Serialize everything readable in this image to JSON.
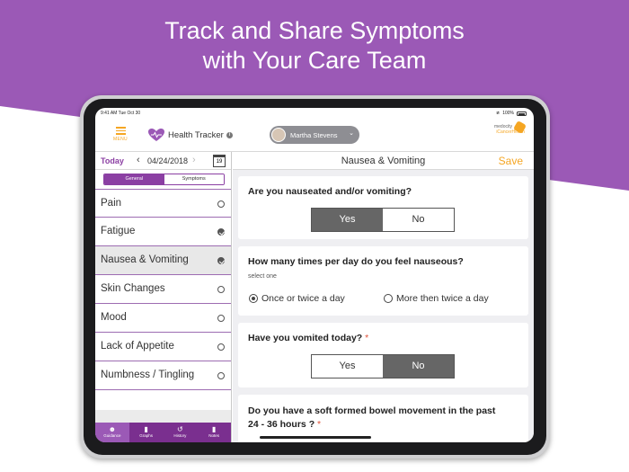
{
  "headline": {
    "line1": "Track and Share Symptoms",
    "line2": "with Your Care Team"
  },
  "colors": {
    "brand_purple": "#9b59b6",
    "dark_purple": "#7a2f8f",
    "accent_orange": "#f5a623",
    "required_red": "#e0533b"
  },
  "statusbar": {
    "time": "9:41 AM  Tue Oct 30",
    "battery": "100%"
  },
  "header": {
    "menu_label": "MENU",
    "app_name": "Health Tracker",
    "info_icon": "i",
    "user_name": "Martha Stevens",
    "partner_line1": "medocity",
    "partner_line2": "iCancerHealth"
  },
  "left": {
    "today_label": "Today",
    "date": "04/24/2018",
    "calendar_day": "19",
    "segment": {
      "general": "General",
      "symptoms": "Symptoms",
      "selected": "General"
    },
    "symptoms": [
      {
        "label": "Pain",
        "checked": false
      },
      {
        "label": "Fatigue",
        "checked": true
      },
      {
        "label": "Nausea & Vomiting",
        "checked": true,
        "active": true
      },
      {
        "label": "Skin Changes",
        "checked": false
      },
      {
        "label": "Mood",
        "checked": false
      },
      {
        "label": "Lack of Appetite",
        "checked": false
      },
      {
        "label": "Numbness / Tingling",
        "checked": false
      }
    ],
    "tabs": [
      {
        "label": "Guidance",
        "icon": "guidance-icon"
      },
      {
        "label": "Graphs",
        "icon": "graphs-icon"
      },
      {
        "label": "History",
        "icon": "history-icon"
      },
      {
        "label": "Notes",
        "icon": "notes-icon"
      }
    ]
  },
  "right": {
    "title": "Nausea & Vomiting",
    "save_label": "Save",
    "q1": {
      "text": "Are you nauseated and/or vomiting?",
      "yes": "Yes",
      "no": "No",
      "selected": "Yes"
    },
    "q2": {
      "text": "How many times per day do you feel nauseous?",
      "hint": "select one",
      "option1": "Once or twice a day",
      "option2": "More then twice a day",
      "selected": "Once or twice a day"
    },
    "q3": {
      "text": "Have you vomited today?",
      "required": "*",
      "yes": "Yes",
      "no": "No",
      "selected": "No"
    },
    "q4": {
      "line1": "Do you have a soft formed bowel movement in the past",
      "line2": "24 - 36 hours ?",
      "required": "*"
    }
  }
}
